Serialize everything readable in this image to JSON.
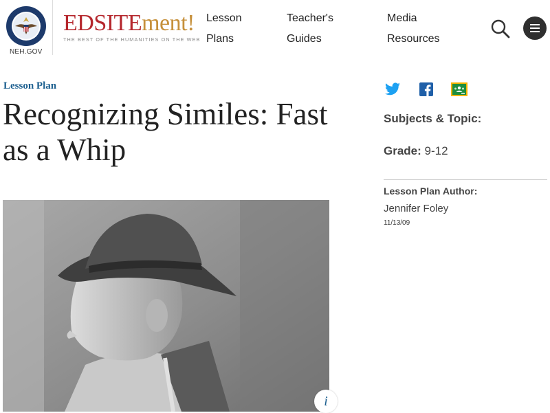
{
  "header": {
    "seal_label": "NEH.GOV",
    "seal_ring_text": "NATIONAL ENDOWMENT FOR THE HUMANITIES",
    "logo_primary": "EDSITE",
    "logo_secondary": "ment!",
    "tagline": "THE BEST OF THE HUMANITIES ON THE WEB",
    "nav": [
      {
        "line1": "Lesson",
        "line2": "Plans"
      },
      {
        "line1": "Teacher's",
        "line2": "Guides"
      },
      {
        "line1": "Media",
        "line2": "Resources"
      }
    ],
    "search_icon": "search-icon",
    "menu_icon": "hamburger-menu-icon"
  },
  "main": {
    "kicker": "Lesson Plan",
    "title": "Recognizing Similes: Fast as a Whip",
    "image_icon": "info-icon",
    "info_glyph": "i"
  },
  "sidebar": {
    "share_icons": [
      "twitter-icon",
      "facebook-icon",
      "google-classroom-icon"
    ],
    "subjects_label": "Subjects & Topic:",
    "grade_label": "Grade:",
    "grade_value": "9-12",
    "author_label": "Lesson Plan Author:",
    "author_name": "Jennifer Foley",
    "date": "11/13/09"
  },
  "colors": {
    "brand_red": "#b5272d",
    "brand_gold": "#c6903b",
    "link_blue": "#1c5f8f",
    "twitter": "#1da1f2",
    "facebook": "#1f5fa8",
    "classroom": "#f5b400"
  }
}
